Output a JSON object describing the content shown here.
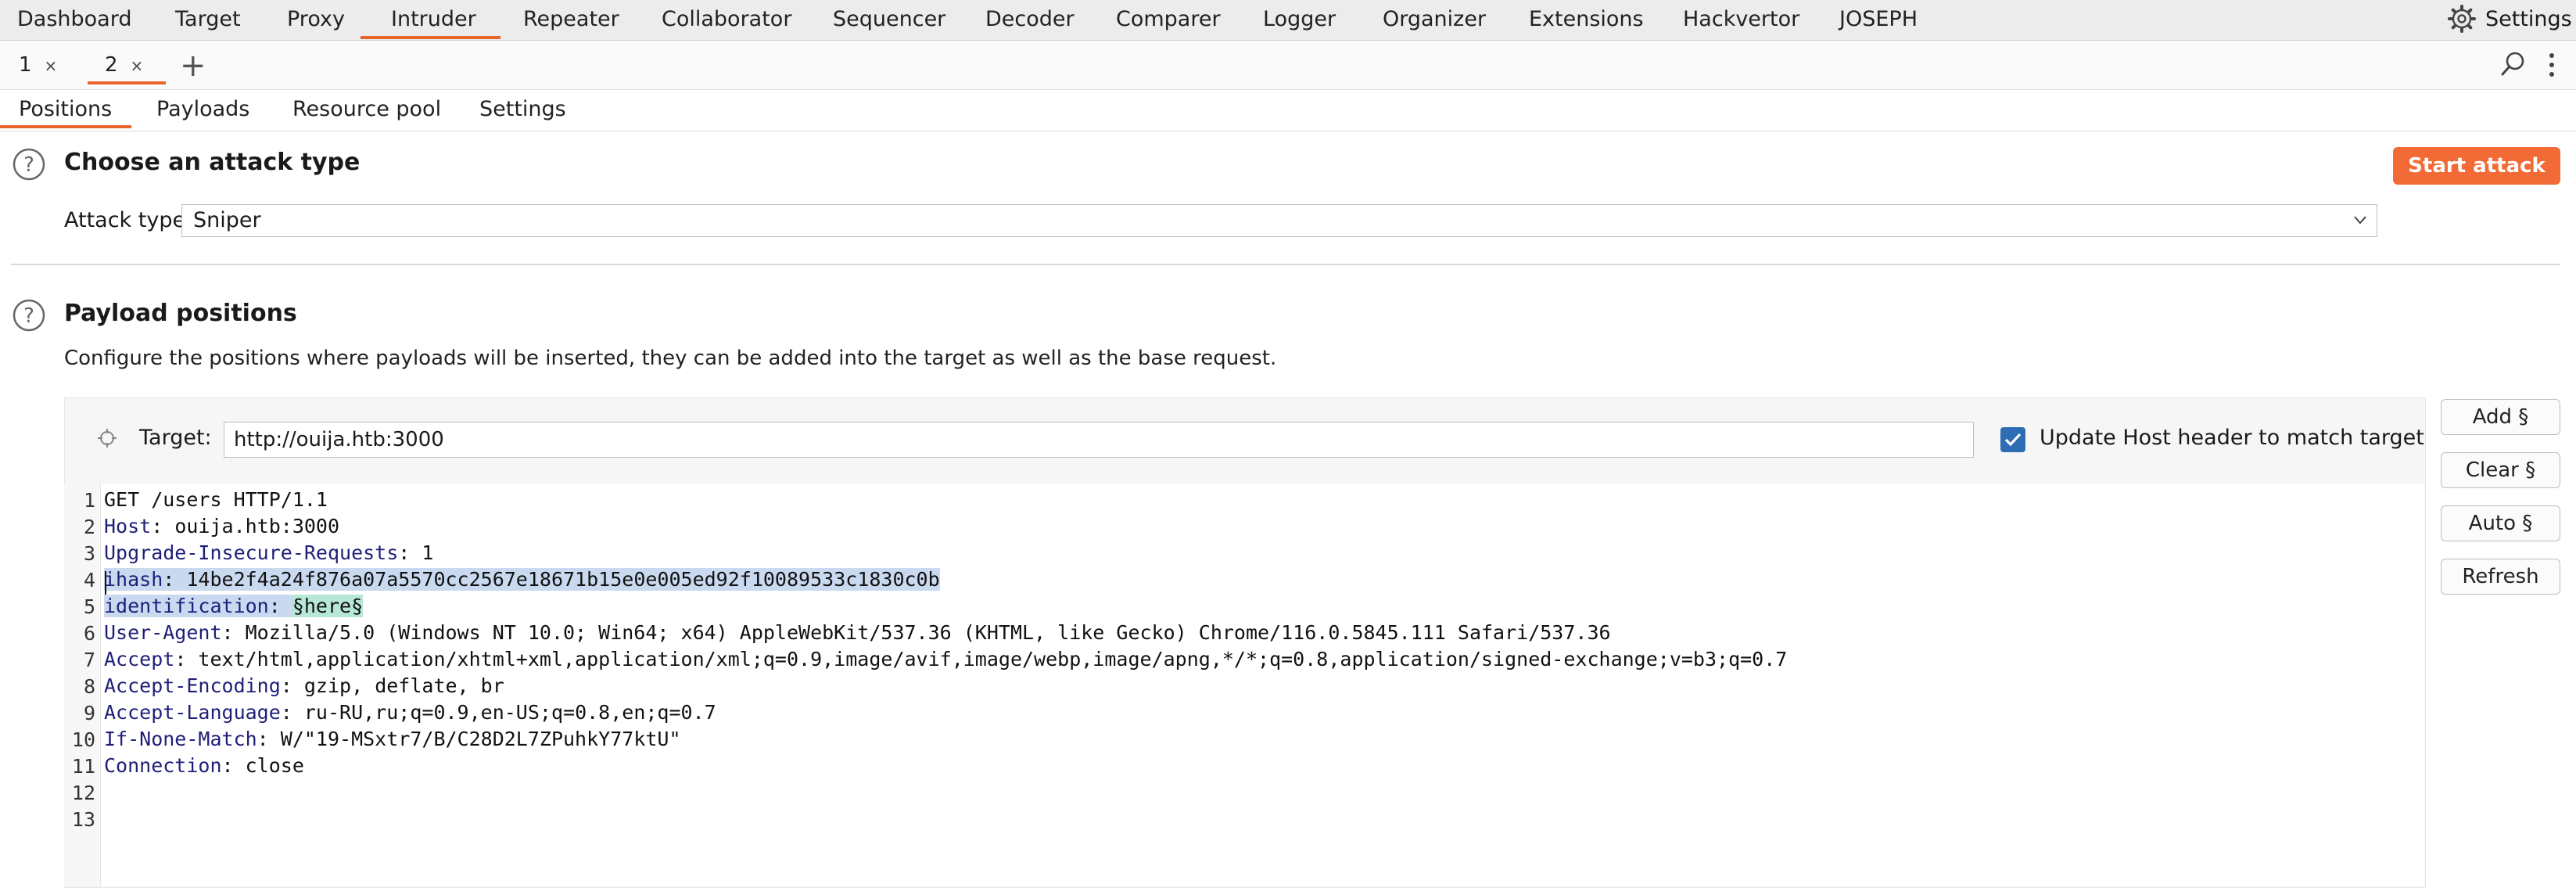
{
  "menu": {
    "items": [
      "Dashboard",
      "Target",
      "Proxy",
      "Intruder",
      "Repeater",
      "Collaborator",
      "Sequencer",
      "Decoder",
      "Comparer",
      "Logger",
      "Organizer",
      "Extensions",
      "Hackvertor",
      "JOSEPH"
    ],
    "active": "Intruder",
    "settings_label": "Settings"
  },
  "tabs": [
    {
      "label": "1",
      "close": "×"
    },
    {
      "label": "2",
      "close": "×"
    }
  ],
  "add_tab": "+",
  "subtabs": [
    "Positions",
    "Payloads",
    "Resource pool",
    "Settings"
  ],
  "attack": {
    "title": "Choose an attack type",
    "label": "Attack type:",
    "value": "Sniper",
    "start_button": "Start attack"
  },
  "payload_positions": {
    "title": "Payload positions",
    "description": "Configure the positions where payloads will be inserted, they can be added into the target as well as the base request.",
    "target_label": "Target:",
    "target_value": "http://ouija.htb:3000",
    "update_host_label": "Update Host header to match target",
    "update_host_checked": true
  },
  "side_buttons": [
    "Add §",
    "Clear §",
    "Auto §",
    "Refresh"
  ],
  "request_lines": [
    {
      "n": "1",
      "name": "",
      "value": "GET /users HTTP/1.1"
    },
    {
      "n": "2",
      "name": "Host",
      "value": ": ouija.htb:3000"
    },
    {
      "n": "3",
      "name": "Upgrade-Insecure-Requests",
      "value": ": 1"
    },
    {
      "n": "4",
      "name": "ihash",
      "value": ": 14be2f4a24f876a07a5570cc2567e18671b15e0e005ed92f10089533c1830c0b"
    },
    {
      "n": "5",
      "name": "identification",
      "value": ": ",
      "payload": "§here§"
    },
    {
      "n": "6",
      "name": "User-Agent",
      "value": ": Mozilla/5.0 (Windows NT 10.0; Win64; x64) AppleWebKit/537.36 (KHTML, like Gecko) Chrome/116.0.5845.111 Safari/537.36"
    },
    {
      "n": "7",
      "name": "Accept",
      "value": ": text/html,application/xhtml+xml,application/xml;q=0.9,image/avif,image/webp,image/apng,*/*;q=0.8,application/signed-exchange;v=b3;q=0.7"
    },
    {
      "n": "8",
      "name": "Accept-Encoding",
      "value": ": gzip, deflate, br"
    },
    {
      "n": "9",
      "name": "Accept-Language",
      "value": ": ru-RU,ru;q=0.9,en-US;q=0.8,en;q=0.7"
    },
    {
      "n": "10",
      "name": "If-None-Match",
      "value": ": W/\"19-MSxtr7/B/C28D2L7ZPuhkY77ktU\""
    },
    {
      "n": "11",
      "name": "Connection",
      "value": ": close"
    },
    {
      "n": "12",
      "name": "",
      "value": ""
    },
    {
      "n": "13",
      "name": "",
      "value": ""
    }
  ],
  "colors": {
    "accent": "#e8652b",
    "start_attack": "#f26a35",
    "checkbox": "#2e6db4",
    "selection": "#c9d9ef",
    "payload_marker": "#b7e7d6"
  }
}
